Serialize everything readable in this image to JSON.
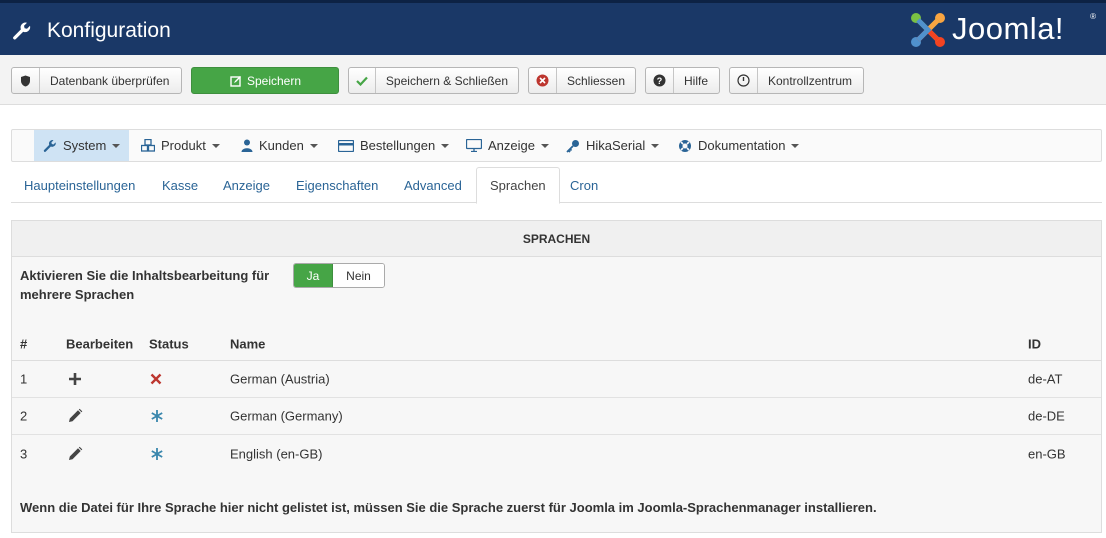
{
  "header": {
    "title": "Konfiguration",
    "logo_text": "Joomla!",
    "logo_reg": "®",
    "bg_color": "#1a3867"
  },
  "toolbar": {
    "check_db": "Datenbank überprüfen",
    "save": "Speichern",
    "save_close": "Speichern & Schließen",
    "close": "Schliessen",
    "help": "Hilfe",
    "control_center": "Kontrollzentrum",
    "save_color": "#46a546"
  },
  "menu": {
    "system": "System",
    "produkt": "Produkt",
    "kunden": "Kunden",
    "bestellungen": "Bestellungen",
    "anzeige": "Anzeige",
    "hikaserial": "HikaSerial",
    "dokumentation": "Dokumentation"
  },
  "tabs": {
    "haupteinstellungen": "Haupteinstellungen",
    "kasse": "Kasse",
    "anzeige": "Anzeige",
    "eigenschaften": "Eigenschaften",
    "advanced": "Advanced",
    "sprachen": "Sprachen",
    "cron": "Cron",
    "active": "Sprachen"
  },
  "panel": {
    "title": "SPRACHEN",
    "option_label": "Aktivieren Sie die Inhaltsbearbeitung für mehrere Sprachen",
    "toggle_yes": "Ja",
    "toggle_no": "Nein",
    "toggle_selected": "Ja",
    "columns": {
      "num": "#",
      "edit": "Bearbeiten",
      "status": "Status",
      "name": "Name",
      "id": "ID"
    },
    "rows": [
      {
        "num": "1",
        "edit_icon": "plus-icon",
        "status_icon": "cross-icon",
        "name": "German (Austria)",
        "id": "de-AT"
      },
      {
        "num": "2",
        "edit_icon": "pencil-icon",
        "status_icon": "asterisk-icon",
        "name": "German (Germany)",
        "id": "de-DE"
      },
      {
        "num": "3",
        "edit_icon": "pencil-icon",
        "status_icon": "asterisk-icon",
        "name": "English (en-GB)",
        "id": "en-GB"
      }
    ],
    "note": "Wenn die Datei für Ihre Sprache hier nicht gelistet ist, müssen Sie die Sprache zuerst für Joomla im Joomla-Sprachenmanager installieren."
  }
}
